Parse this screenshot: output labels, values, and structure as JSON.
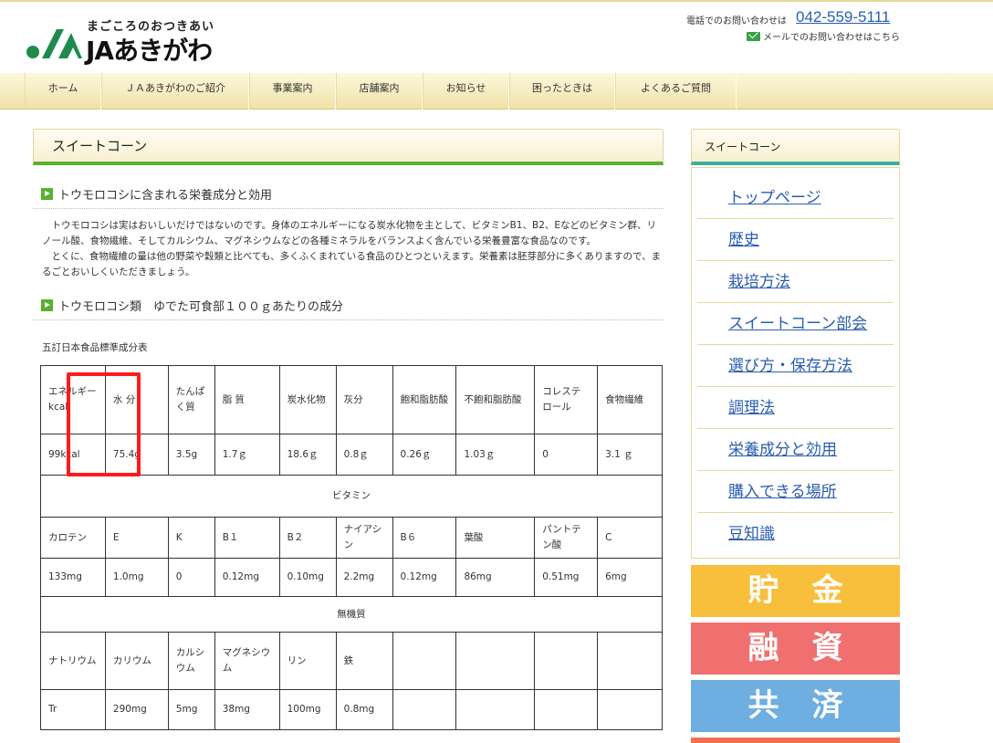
{
  "header": {
    "logo_tagline": "まごころのおつきあい",
    "logo_name": "JAあきがわ",
    "contact_label": "電話でのお問い合わせは",
    "phone": "042-559-5111",
    "mail_label": "メールでのお問い合わせはこちら"
  },
  "nav": [
    "ホーム",
    "ＪＡあきがわのご紹介",
    "事業案内",
    "店舗案内",
    "お知らせ",
    "困ったときは",
    "よくあるご質問"
  ],
  "main": {
    "title": "スイートコーン",
    "section1": "トウモロコシに含まれる栄養成分と効用",
    "para1": "トウモロコシは実はおいしいだけではないのです。身体のエネルギーになる炭水化物を主として、ビタミンB1、B2、Eなどのビタミン群、リノール酸、食物繊維、そしてカルシウム、マグネシウムなどの各種ミネラルをバランスよく含んでいる栄養豊富な食品なのです。",
    "para2": "とくに、食物繊維の量は他の野菜や穀類と比べても、多くふくまれている食品のひとつといえます。栄養素は胚芽部分に多くありますので、まるごとおいしくいただきましょう。",
    "section2": "トウモロコシ類　ゆでた可食部１００ｇあたりの成分",
    "source": "五訂日本食品標準成分表"
  },
  "table": {
    "row1_head": [
      "エネルギーkcal",
      "水 分",
      "たんぱく質",
      "脂 質",
      "炭水化物",
      "灰分",
      "飽和脂肪酸",
      "不飽和脂肪酸",
      "コレステロール",
      "食物繊維"
    ],
    "row1_val": [
      "99kcal",
      "75.4g",
      "3.5g",
      "1.7ｇ",
      "18.6ｇ",
      "0.8ｇ",
      "0.26ｇ",
      "1.03ｇ",
      "0",
      "3.1 ｇ"
    ],
    "vitamin_label": "ビタミン",
    "row2_head": [
      "カロテン",
      "E",
      "K",
      "B１",
      "B２",
      "ナイアシン",
      "B６",
      "葉酸",
      "パントテン酸",
      "C"
    ],
    "row2_val": [
      "133mg",
      "1.0mg",
      "0",
      "0.12mg",
      "0.10mg",
      "2.2mg",
      "0.12mg",
      "86mg",
      "0.51mg",
      "6mg"
    ],
    "mineral_label": "無機質",
    "row3_head": [
      "ナトリウム",
      "カリウム",
      "カルシウム",
      "マグネシウム",
      "リン",
      "鉄",
      "",
      "",
      "",
      ""
    ],
    "row3_val": [
      "Tr",
      "290mg",
      "5mg",
      "38mg",
      "100mg",
      "0.8mg",
      "",
      "",
      "",
      ""
    ]
  },
  "sidebar": {
    "title": "スイートコーン",
    "items": [
      "トップページ",
      "歴史",
      "栽培方法",
      "スイートコーン部会",
      "選び方・保存方法",
      "調理法",
      "栄養成分と効用",
      "購入できる場所",
      "豆知識"
    ]
  },
  "banners": [
    "貯金",
    "融資",
    "共済"
  ]
}
